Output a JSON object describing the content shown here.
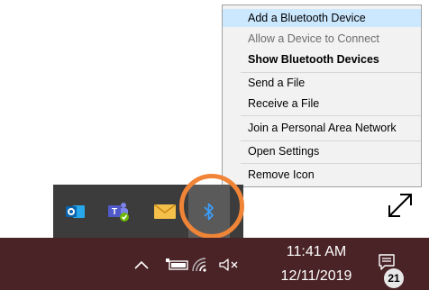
{
  "context_menu": {
    "items": [
      {
        "label": "Add a Bluetooth Device",
        "state": "hover"
      },
      {
        "label": "Allow a Device to Connect",
        "state": "disabled"
      },
      {
        "label": "Show Bluetooth Devices",
        "state": "default"
      },
      {
        "label": "Send a File",
        "state": "normal"
      },
      {
        "label": "Receive a File",
        "state": "normal"
      },
      {
        "label": "Join a Personal Area Network",
        "state": "normal"
      },
      {
        "label": "Open Settings",
        "state": "normal"
      },
      {
        "label": "Remove Icon",
        "state": "normal"
      }
    ]
  },
  "tray_flyout": {
    "icons": [
      "outlook-icon",
      "teams-icon",
      "mail-icon",
      "bluetooth-icon"
    ],
    "highlight_color": "#f08437"
  },
  "taskbar": {
    "background": "#4a2326",
    "time": "11:41 AM",
    "date": "12/11/2019",
    "notification_count": "21"
  }
}
